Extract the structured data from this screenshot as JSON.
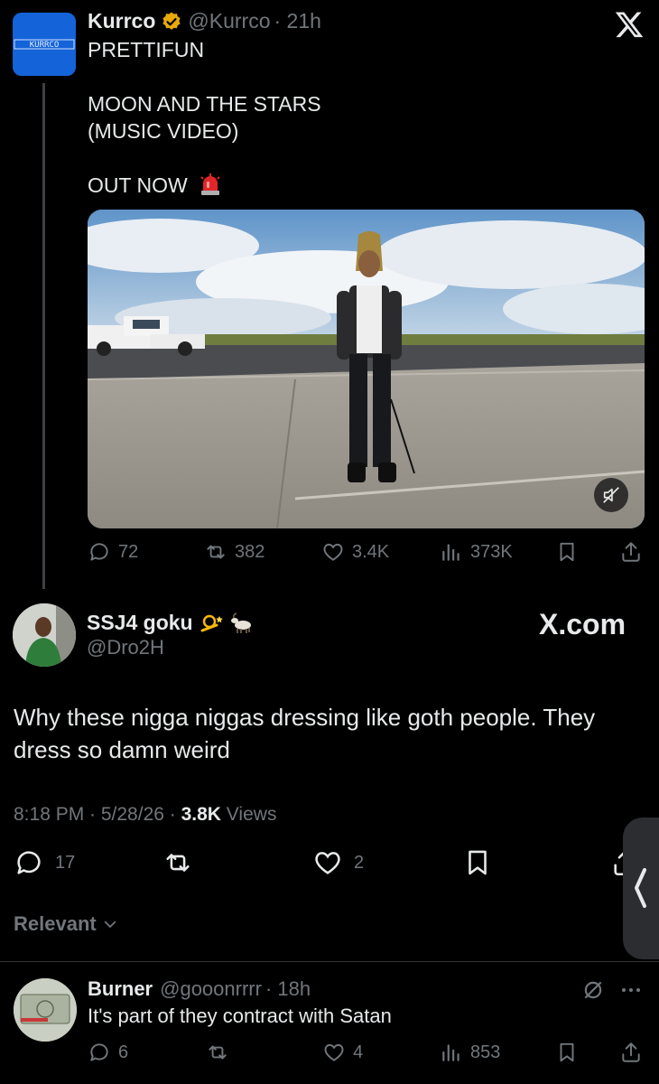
{
  "quoted_tweet": {
    "avatar_text": "KURRCO",
    "name": "Kurrco",
    "handle": "@Kurrco",
    "time": "· 21h",
    "lines": [
      "PRETTIFUN",
      "",
      "MOON AND THE STARS",
      "(MUSIC VIDEO)",
      "",
      "OUT NOW"
    ],
    "stats": {
      "replies": "72",
      "reposts": "382",
      "likes": "3.4K",
      "views": "373K"
    }
  },
  "main_tweet": {
    "name": "SSJ4 goku",
    "handle": "@Dro2H",
    "watermark": "X.com",
    "body": "Why these nigga niggas dressing like goth people. They dress so damn weird",
    "timestamp": "8:18 PM · 5/28/26 · ",
    "views_count": "3.8K",
    "views_label": " Views",
    "stats": {
      "replies": "17",
      "likes": "2"
    },
    "sort_label": "Relevant"
  },
  "reply": {
    "name": "Burner",
    "handle": "@gooonrrrr",
    "time": "· 18h",
    "text": "It's part of they contract with Satan",
    "stats": {
      "replies": "6",
      "likes": "4",
      "views": "853"
    }
  },
  "colors": {
    "accent": "#1d9bf0",
    "muted": "#71767b",
    "verified": "#e8a90c"
  }
}
